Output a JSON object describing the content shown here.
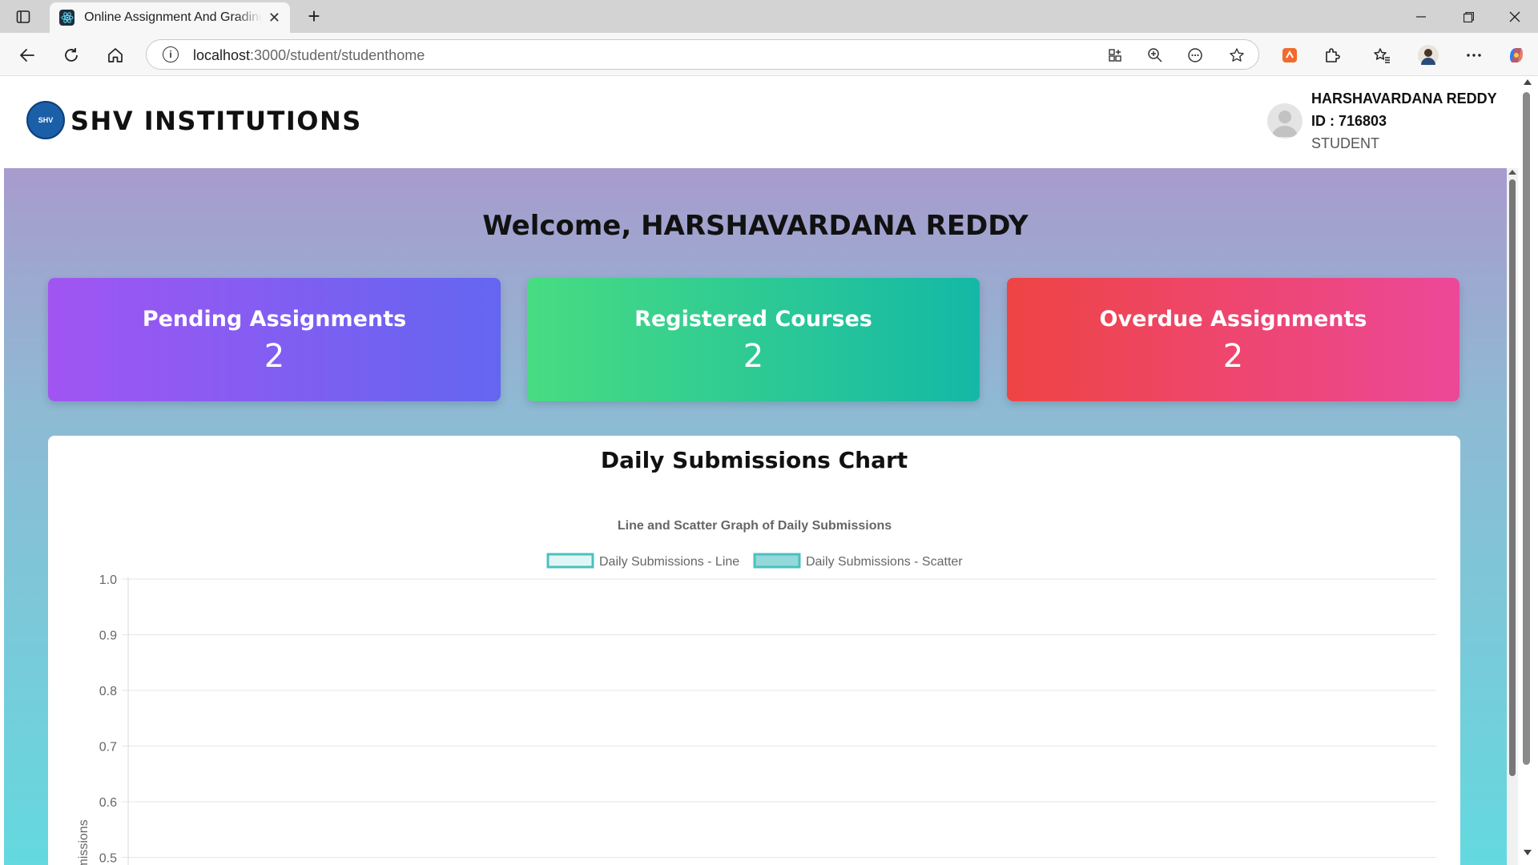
{
  "browser": {
    "tab_title": "Online Assignment And Grading System",
    "url_host": "localhost",
    "url_path": ":3000/student/studenthome",
    "icons": [
      "sidebar-icon",
      "react-favicon",
      "close-icon",
      "plus-icon",
      "minimize-icon",
      "restore-icon",
      "close-window-icon",
      "back-icon",
      "reload-icon",
      "home-icon",
      "info-icon",
      "app-install-icon",
      "zoom-icon",
      "read-aloud-icon",
      "star-icon",
      "extension-orange-icon",
      "puzzle-icon",
      "favorites-icon",
      "profile-icon",
      "more-icon",
      "copilot-icon"
    ]
  },
  "header": {
    "brand": "SHV INSTITUTIONS",
    "logo_text": "SHV",
    "user_name": "HARSHAVARDANA REDDY",
    "user_id": "ID : 716803",
    "user_role": "STUDENT"
  },
  "main": {
    "welcome": "Welcome, HARSHAVARDANA REDDY",
    "cards": [
      {
        "label": "Pending Assignments",
        "value": "2",
        "colors": [
          "#a155f2",
          "#6366f1"
        ]
      },
      {
        "label": "Registered Courses",
        "value": "2",
        "colors": [
          "#48dc82",
          "#14b8a6"
        ]
      },
      {
        "label": "Overdue Assignments",
        "value": "2",
        "colors": [
          "#ef4444",
          "#ec4899"
        ]
      }
    ],
    "chart_heading": "Daily Submissions Chart"
  },
  "chart_data": {
    "type": "line",
    "title": "Line and Scatter Graph of Daily Submissions",
    "ylabel": "Submissions",
    "ylim": [
      0.5,
      1.0
    ],
    "yticks": [
      "1.0",
      "0.9",
      "0.8",
      "0.7",
      "0.6",
      "0.5"
    ],
    "grid": true,
    "legend_position": "top",
    "series": [
      {
        "name": "Daily Submissions - Line",
        "values": [],
        "color": "#4bc0c0",
        "fill": "#e0f6f6"
      },
      {
        "name": "Daily Submissions - Scatter",
        "values": [],
        "color": "#4bc0c0",
        "fill": "#93d9d9"
      }
    ]
  }
}
